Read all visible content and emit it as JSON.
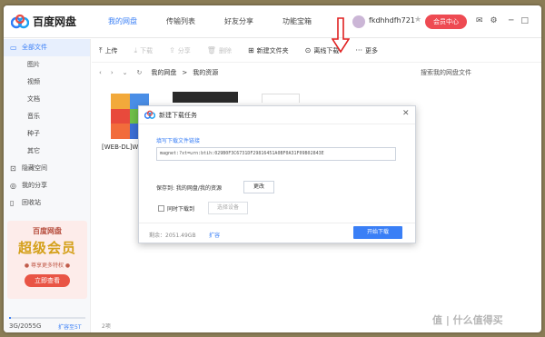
{
  "app": {
    "logo_text": "百度网盘"
  },
  "nav": [
    "我的网盘",
    "传输列表",
    "好友分享",
    "功能宝箱"
  ],
  "user": {
    "name": "fkdhhdfh721",
    "vip_button": "会员中心"
  },
  "sidebar": {
    "items": [
      {
        "label": "全部文件",
        "main": true,
        "active": true,
        "icon": "folder-icon"
      },
      {
        "label": "图片"
      },
      {
        "label": "视频"
      },
      {
        "label": "文档"
      },
      {
        "label": "音乐"
      },
      {
        "label": "种子"
      },
      {
        "label": "其它"
      },
      {
        "label": "隐藏空间",
        "main": true,
        "icon": "lock-icon"
      },
      {
        "label": "我的分享",
        "main": true,
        "icon": "share-icon"
      },
      {
        "label": "回收站",
        "main": true,
        "icon": "trash-icon"
      }
    ],
    "promo": {
      "line1": "百度网盘",
      "line2": "超级会员",
      "line3": "● 尊享更多特权 ●",
      "button": "立即查看"
    },
    "quota": {
      "text": "3G/2055G",
      "expand": "扩容至5T",
      "fraction": 0.0015
    }
  },
  "toolbar": {
    "items": [
      {
        "label": "上传",
        "icon": "upload-icon",
        "glyph": "⤒",
        "enabled": true
      },
      {
        "label": "下载",
        "icon": "download-icon",
        "glyph": "⤓",
        "enabled": false
      },
      {
        "label": "分享",
        "icon": "share-icon",
        "glyph": "⇪",
        "enabled": false
      },
      {
        "label": "删除",
        "icon": "trash-icon",
        "glyph": "🗑",
        "enabled": false
      },
      {
        "label": "新建文件夹",
        "icon": "new-folder-icon",
        "glyph": "⊞",
        "enabled": true
      },
      {
        "label": "离线下载",
        "icon": "offline-download-icon",
        "glyph": "⊙",
        "enabled": true
      },
      {
        "label": "更多",
        "icon": "more-icon",
        "glyph": "···",
        "enabled": true
      }
    ]
  },
  "path": {
    "crumbs": [
      "我的网盘",
      ">",
      "我的资源"
    ],
    "search": "搜索我的网盘文件"
  },
  "files": {
    "first_name": "[WEB-DL]W",
    "count": "2项"
  },
  "modal": {
    "title": "新建下载任务",
    "label": "填写下载文件链接",
    "link": "magnet:?xt=urn:btih:029B0F3C6731DF29816451A0BF0A31F09B02843E",
    "save_to": "保存到: 我的网盘/我的资源",
    "change": "更改",
    "sync": "同时下载到",
    "device": "选择设备",
    "space": "剩余：2051.49GB",
    "expand": "扩容",
    "start": "开始下载"
  },
  "watermark": "值 | 什么值得买",
  "colors": {
    "accent": "#3a7ff6",
    "vip": "#ee4a52",
    "arrow": "#e02020"
  }
}
